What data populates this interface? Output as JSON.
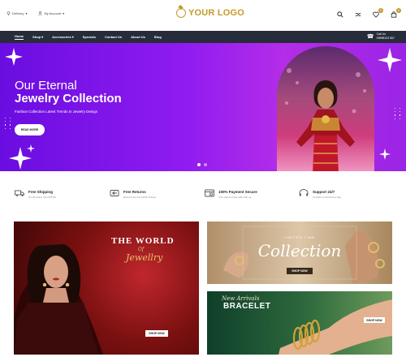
{
  "topbar": {
    "delivery_label": "Delivery",
    "account_label": "My Account",
    "logo_text": "YOUR LOGO",
    "wishlist_count": "0",
    "cart_count": "0"
  },
  "nav": {
    "items": [
      {
        "label": "Home",
        "active": true
      },
      {
        "label": "Shop",
        "dropdown": true
      },
      {
        "label": "Accessories",
        "dropdown": true
      },
      {
        "label": "Specials"
      },
      {
        "label": "Contact Us"
      },
      {
        "label": "About Us"
      },
      {
        "label": "Blog"
      }
    ],
    "call_label": "Call Us",
    "call_number": "09898123 567"
  },
  "hero": {
    "line1": "Our Eternal",
    "line2": "Jewelry Collection",
    "subtitle": "Fashion Collection Latest Trends In Jewelry Design",
    "button": "READ MORE"
  },
  "features": [
    {
      "title": "Free Shipping",
      "desc": "On all orders over $75.00",
      "icon": "truck-icon"
    },
    {
      "title": "Free Returns",
      "desc": "Returns are free within 9 days",
      "icon": "returns-icon"
    },
    {
      "title": "100% Payment Secure",
      "desc": "Your payment are safe with us.",
      "icon": "secure-payment-icon"
    },
    {
      "title": "Support 24/7",
      "desc": "Contact us 24 hours a day",
      "icon": "support-icon"
    }
  ],
  "banners": {
    "world": {
      "line1": "THE WORLD",
      "line2": "Of",
      "line3": "Jewellry",
      "button": "SHOP NOW"
    },
    "collection": {
      "label": "LIMITED TIME",
      "title": "Collection",
      "button": "SHOP NOW"
    },
    "bracelet": {
      "line1": "New Arrivals",
      "line2": "BRACELET",
      "button": "SHOP NOW"
    }
  },
  "colors": {
    "brand_gold": "#c49a2c",
    "nav_bg": "#262c3a",
    "hero_purple": "#8f1bf0"
  }
}
